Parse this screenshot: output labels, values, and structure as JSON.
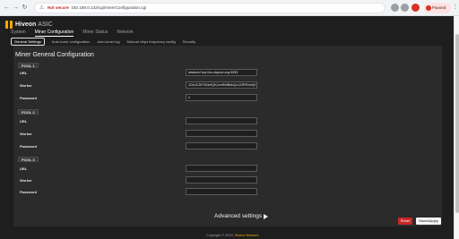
{
  "browser": {
    "warning": "Not secure",
    "url": "192.168.0.142/cgi/minerConfiguration.cgi",
    "profile_label": "Paused"
  },
  "app": {
    "brand": "Hiveon",
    "product": "ASIC"
  },
  "mainnav": {
    "items": [
      "System",
      "Miner Configuration",
      "Miner Status",
      "Network"
    ],
    "active": "Miner Configuration"
  },
  "subnav": {
    "items": [
      "General Settings",
      "Auto-tuner configuration",
      "Auto-tuner log",
      "Manual chips frequency config",
      "Security"
    ]
  },
  "panel": {
    "title": "Miner General Configuration",
    "pools": [
      {
        "label": "POOL 1",
        "url": "stratum+tcp://eu.ckpool.org:3333",
        "worker": "1DhJCDF3Cik9QKUmRMBbbQc1ZRPDeVjK9dwh",
        "password": "x"
      },
      {
        "label": "POOL 2",
        "url": "",
        "worker": "",
        "password": ""
      },
      {
        "label": "POOL 3",
        "url": "",
        "worker": "",
        "password": ""
      }
    ],
    "field_labels": {
      "url": "URL",
      "worker": "Worker",
      "password": "Password"
    },
    "advanced": "Advanced settings"
  },
  "actions": {
    "reset": "Reset",
    "save": "Save&Apply"
  },
  "footer": {
    "prefix": "Copyright © 2019,",
    "brand": "Hiveon Network"
  },
  "colors": {
    "accent": "#f2a900",
    "background": "#1e1e1e",
    "panel": "#2b2b2b",
    "reset": "#c62828"
  }
}
